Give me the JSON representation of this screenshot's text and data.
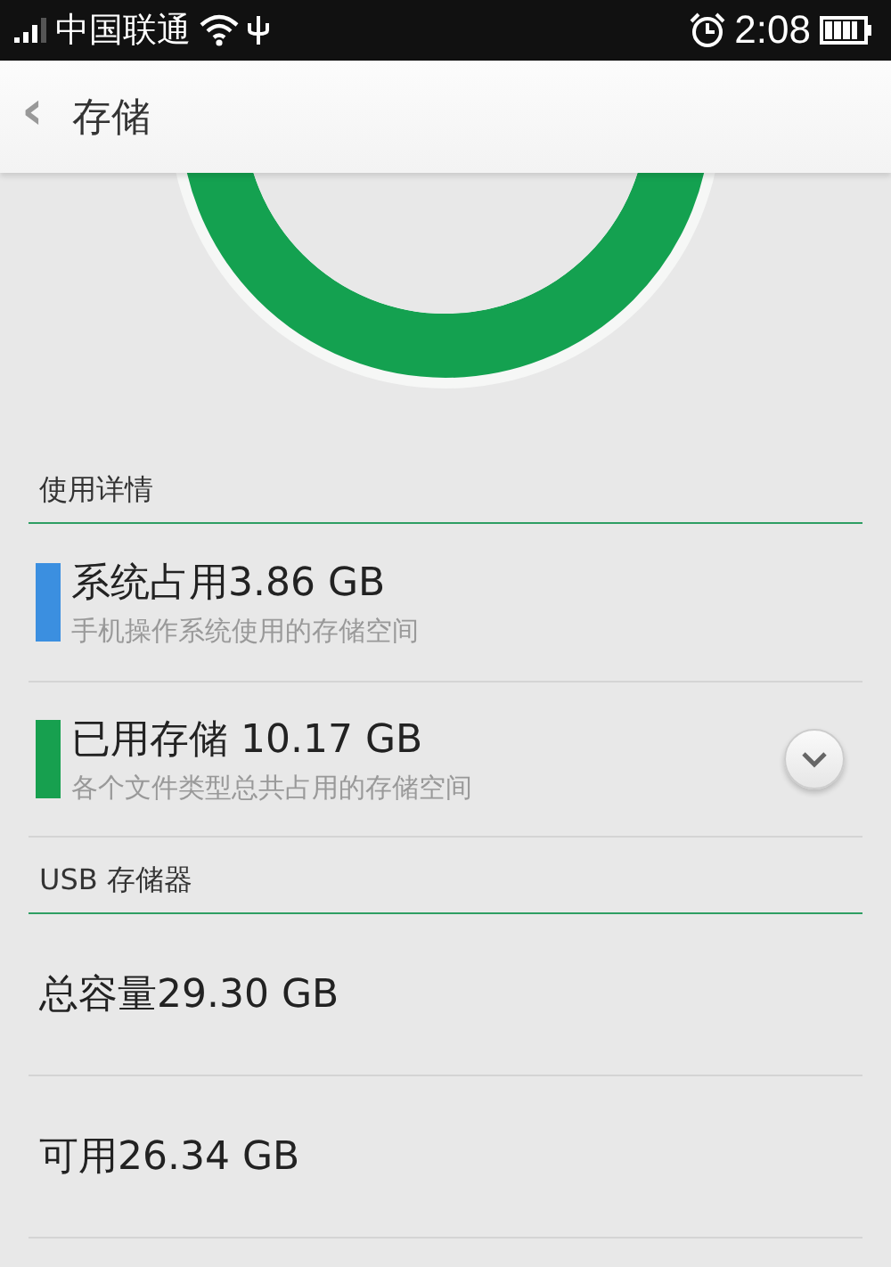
{
  "status_bar": {
    "carrier": "中国联通",
    "time": "2:08"
  },
  "header": {
    "back": "‹",
    "title": "存储"
  },
  "sections": [
    {
      "title": "使用详情",
      "items": [
        {
          "kind": "detail",
          "title": "系统占用3.86 GB",
          "subtitle": "手机操作系统使用的存储空间",
          "color": "#3b8fe0"
        },
        {
          "kind": "detail",
          "title": "已用存储 10.17 GB",
          "subtitle": "各个文件类型总共占用的存储空间",
          "color": "#17a04f",
          "expanded": false
        }
      ]
    },
    {
      "title": "USB 存储器",
      "items": [
        {
          "kind": "plain",
          "title": "总容量29.30 GB"
        },
        {
          "kind": "plain",
          "title": "可用26.34 GB"
        }
      ]
    }
  ]
}
